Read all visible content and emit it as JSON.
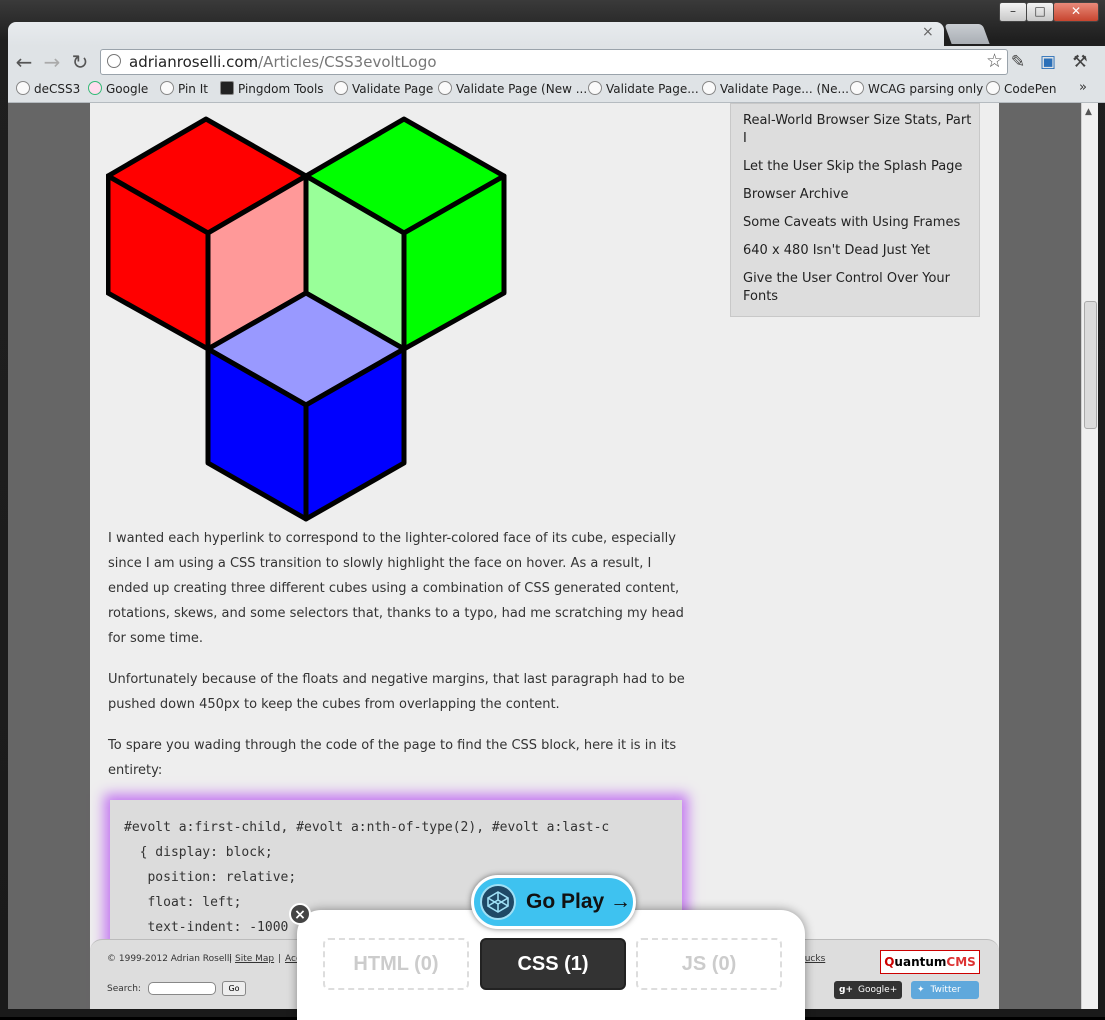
{
  "browser": {
    "url_host": "adrianroselli.com",
    "url_path": "/Articles/CSS3evoltLogo",
    "tab_close": "×",
    "win_min": "–",
    "win_max": "□",
    "win_close": "✕",
    "bookmarks": [
      "deCSS3",
      "Google",
      "Pin It",
      "Pingdom Tools",
      "Validate Page",
      "Validate Page (New ...",
      "Validate Page...",
      "Validate Page... (Ne...",
      "WCAG parsing only",
      "CodePen"
    ],
    "bookmarks_more": "»"
  },
  "sidebar": {
    "links": [
      "Real-World Browser Size Stats, Part I",
      "Let the User Skip the Splash Page",
      "Browser Archive",
      "Some Caveats with Using Frames",
      "640 x 480 Isn't Dead Just Yet",
      "Give the User Control Over Your Fonts"
    ]
  },
  "article": {
    "paragraphs": [
      "I wanted each hyperlink to correspond to the lighter-colored face of its cube, especially since I am using a CSS transition to slowly highlight the face on hover. As a result, I ended up creating three different cubes using a combination of CSS generated content, rotations, skews, and some selectors that, thanks to a typo, had me scratching my head for some time.",
      "Unfortunately because of the floats and negative margins, that last paragraph had to be pushed down 450px to keep the cubes from overlapping the content.",
      "To spare you wading through the code of the page to find the CSS block, here it is in its entirety:"
    ],
    "code_lines": [
      "#evolt a:first-child, #evolt a:nth-of-type(2), #evolt a:last-c",
      "  { display: block;",
      "   position: relative;",
      "   float: left;",
      "   text-indent: -1000"
    ]
  },
  "footer": {
    "copyright": "© 1999-2012 Adrian Roselli",
    "sep": "|",
    "sitemap": "Site Map",
    "acc": "Acc",
    "trucks": "rucks",
    "search_label": "Search:",
    "go": "Go",
    "logo_q": "Q",
    "logo_uantum": "uantum",
    "logo_cms": "CMS",
    "gplus": "Google+",
    "gplus_mark": "g+",
    "twitter": "Twitter"
  },
  "codepen": {
    "go_play": "Go Play →",
    "close": "×",
    "tabs": [
      "HTML (0)",
      "CSS (1)",
      "JS (0)"
    ]
  },
  "colors": {
    "cube_red": "#ff0000",
    "cube_red_light": "#ff9999",
    "cube_green": "#00ff00",
    "cube_green_light": "#99ff99",
    "cube_blue": "#0000ff",
    "cube_blue_light": "#9999ff",
    "code_glow": "#c57cf0",
    "codepen_accent": "#3ec2f0"
  }
}
